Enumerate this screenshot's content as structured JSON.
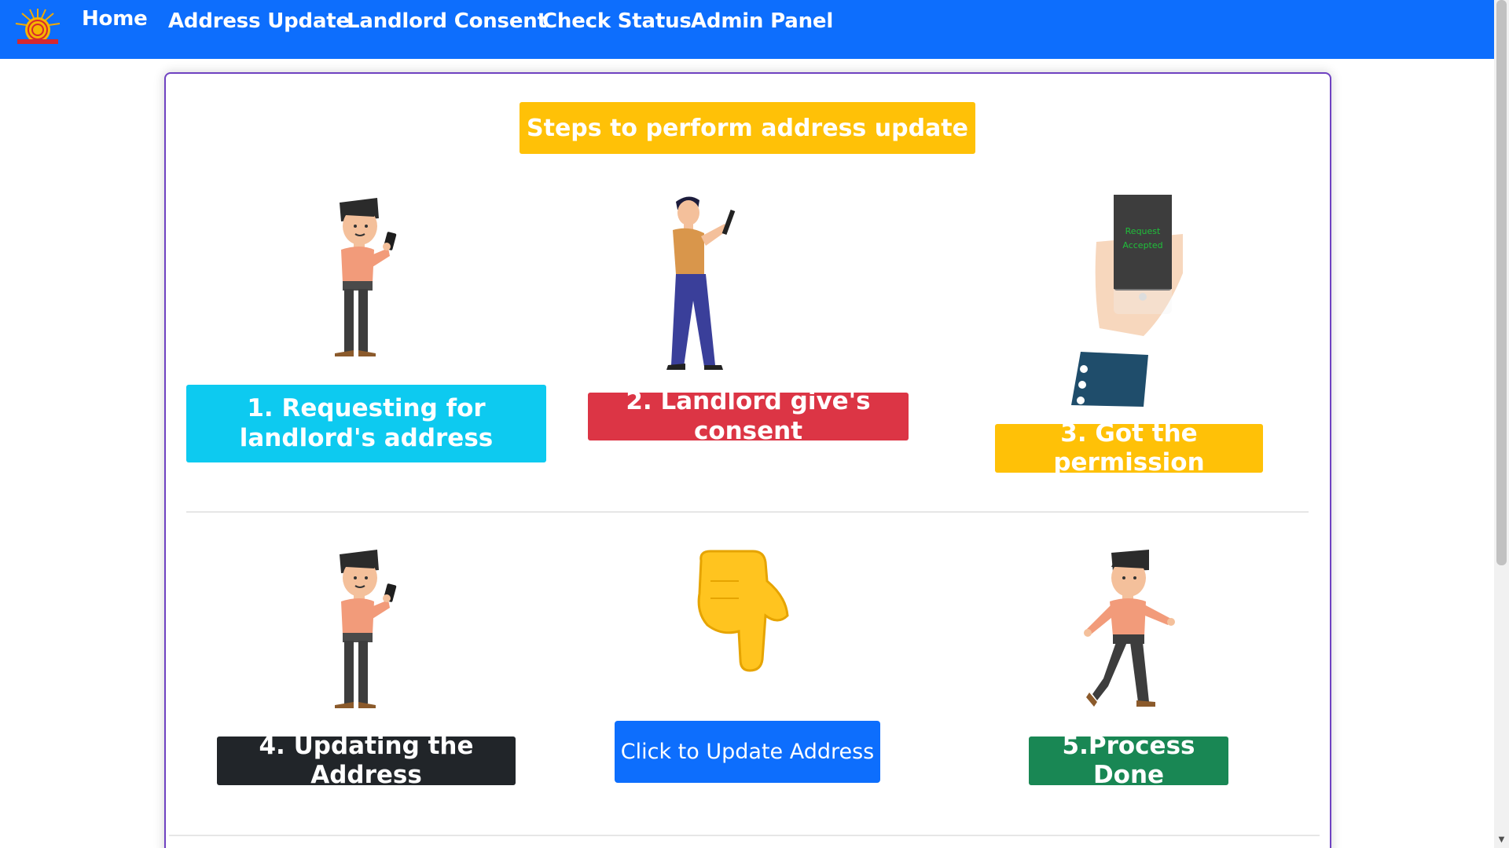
{
  "nav": {
    "items": [
      {
        "label": "Home"
      },
      {
        "label": "Address Update"
      },
      {
        "label": "Landlord Consent"
      },
      {
        "label": "Check Status"
      },
      {
        "label": "Admin Panel"
      }
    ]
  },
  "main": {
    "heading": "Steps to perform address update",
    "steps": [
      {
        "label": "1. Requesting for landlord's address",
        "color": "#0dcaf0"
      },
      {
        "label": "2. Landlord give's consent",
        "color": "#dc3545"
      },
      {
        "label": "3. Got the permission",
        "color": "#ffc107"
      },
      {
        "label": "4. Updating the Address",
        "color": "#212529"
      },
      {
        "label": "5.Process Done",
        "color": "#198754"
      }
    ],
    "update_button": "Click to Update Address",
    "phone_screen_text": [
      "Request",
      "Accepted"
    ]
  },
  "colors": {
    "navbar": "#0d6efd",
    "card_border": "#6f42c1",
    "heading_badge": "#ffc107",
    "button": "#0d6efd"
  },
  "icons": {
    "logo": "aadhaar-sun-logo",
    "step1": "man-with-phone-illustration",
    "step2": "woman-with-phone-illustration",
    "step3": "hand-holding-phone-illustration",
    "step4": "man-with-phone-illustration",
    "pointer": "pointing-down-hand-icon",
    "step5": "walking-man-illustration"
  }
}
